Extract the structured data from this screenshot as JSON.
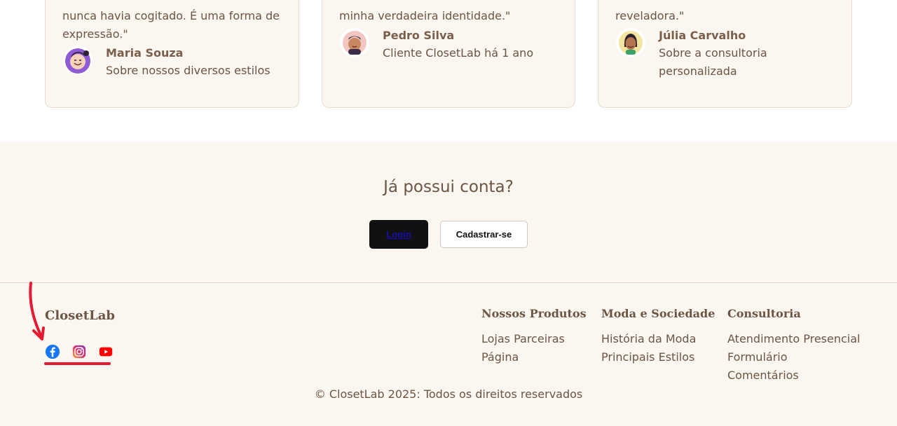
{
  "testimonials": [
    {
      "quote_lines": [
        "nunca havia cogitado. É uma forma de",
        "expressão.\""
      ],
      "name": "Maria Souza",
      "subtitle_lines": [
        "Sobre nossos diversos estilos"
      ],
      "avatar_icon": "avatar-purple-icon"
    },
    {
      "quote_lines": [
        "minha verdadeira identidade.\""
      ],
      "name": "Pedro Silva",
      "subtitle_lines": [
        "Cliente ClosetLab há 1 ano"
      ],
      "avatar_icon": "avatar-pink-icon"
    },
    {
      "quote_lines": [
        "reveladora.\""
      ],
      "name": "Júlia Carvalho",
      "subtitle_lines": [
        "Sobre a consultoria",
        "personalizada"
      ],
      "avatar_icon": "avatar-yellow-icon"
    }
  ],
  "account": {
    "title": "Já possui conta?",
    "login_label": "Login",
    "signup_label": "Cadastrar-se"
  },
  "footer": {
    "brand": "ClosetLab",
    "socials": [
      "facebook-icon",
      "instagram-icon",
      "youtube-icon"
    ],
    "columns": [
      {
        "title": "Nossos Produtos",
        "links": [
          "Lojas Parceiras",
          "Página"
        ]
      },
      {
        "title": "Moda e Sociedade",
        "links": [
          "História da Moda",
          "Principais Estilos"
        ]
      },
      {
        "title": "Consultoria",
        "links": [
          "Atendimento Presencial",
          "Formulário",
          "Comentários"
        ]
      }
    ],
    "copyright": "© ClosetLab 2025: Todos os direitos reservados"
  },
  "colors": {
    "text": "#6b5544",
    "panel_bg": "#fcf6f1",
    "annotation_red": "#e5192f"
  }
}
